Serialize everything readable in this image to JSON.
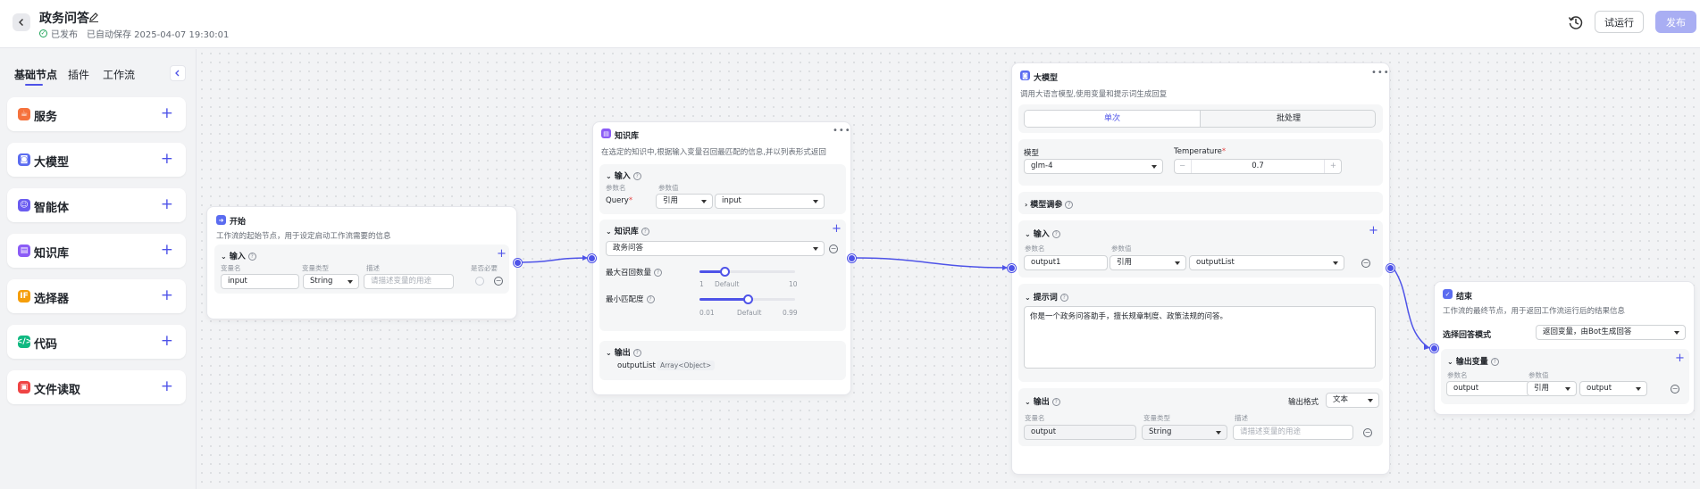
{
  "header": {
    "title": "政务问答",
    "status": "已发布",
    "autosave": "已自动保存 2025-04-07 19:30:01",
    "run_label": "试运行",
    "publish_label": "发布"
  },
  "sidebar": {
    "tabs": [
      "基础节点",
      "插件",
      "工作流"
    ],
    "items": [
      {
        "label": "服务",
        "icon": "service-icon",
        "color": "#f5723d"
      },
      {
        "label": "大模型",
        "icon": "llm-icon",
        "color": "#5b6cf0"
      },
      {
        "label": "智能体",
        "icon": "agent-icon",
        "color": "#6a5cf0"
      },
      {
        "label": "知识库",
        "icon": "knowledge-icon",
        "color": "#8b5cf6"
      },
      {
        "label": "选择器",
        "icon": "selector-icon",
        "color": "#f59e0b"
      },
      {
        "label": "代码",
        "icon": "code-icon",
        "color": "#10b981"
      },
      {
        "label": "文件读取",
        "icon": "file-read-icon",
        "color": "#ef4444"
      }
    ]
  },
  "nodes": {
    "start": {
      "title": "开始",
      "desc": "工作流的起始节点，用于设定启动工作流需要的信息",
      "input_title": "输入",
      "col_name": "变量名",
      "col_type": "变量类型",
      "col_desc": "描述",
      "col_required": "是否必要",
      "var_name": "input",
      "var_type": "String",
      "desc_placeholder": "请描述变量的用途"
    },
    "knowledge": {
      "title": "知识库",
      "desc": "在选定的知识中,根据输入变量召回最匹配的信息,并以列表形式返回",
      "input_title": "输入",
      "col_param": "参数名",
      "col_value": "参数值",
      "query_label": "Query",
      "ref_label": "引用",
      "ref_value": "input",
      "kb_title": "知识库",
      "kb_value": "政务问答",
      "max_recall_label": "最大召回数量",
      "max_recall_min": "1",
      "max_recall_default": "Default",
      "max_recall_max": "10",
      "max_recall_value": 0.26,
      "min_match_label": "最小匹配度",
      "min_match_min": "0.01",
      "min_match_default": "Default",
      "min_match_max": "0.99",
      "min_match_value": 0.5,
      "output_title": "输出",
      "output_name": "outputList",
      "output_type": "Array<Object>"
    },
    "llm": {
      "title": "大模型",
      "desc": "调用大语言模型,使用变量和提示词生成回复",
      "tab_single": "单次",
      "tab_batch": "批处理",
      "model_label": "模型",
      "model_value": "glm-4",
      "temp_label": "Temperature",
      "temp_value": "0.7",
      "tune_label": "模型调参",
      "input_title": "输入",
      "col_param": "参数名",
      "col_value": "参数值",
      "in_name": "output1",
      "in_ref": "引用",
      "in_value": "outputList",
      "prompt_title": "提示词",
      "prompt_text": "你是一个政务问答助手，擅长规章制度、政策法规的问答。",
      "output_title": "输出",
      "output_format_label": "输出格式",
      "output_format_value": "文本",
      "col_name": "变量名",
      "col_type": "变量类型",
      "col_desc": "描述",
      "out_name": "output",
      "out_type": "String",
      "out_desc_placeholder": "请描述变量的用途"
    },
    "end": {
      "title": "结束",
      "desc": "工作流的最终节点，用于返回工作流运行后的结果信息",
      "mode_label": "选择回答模式",
      "mode_value": "返回变量，由Bot生成回答",
      "out_title": "输出变量",
      "col_param": "参数名",
      "col_value": "参数值",
      "var_name": "output",
      "ref_label": "引用",
      "ref_value": "output"
    }
  },
  "colors": {
    "accent": "#4e53e8"
  }
}
